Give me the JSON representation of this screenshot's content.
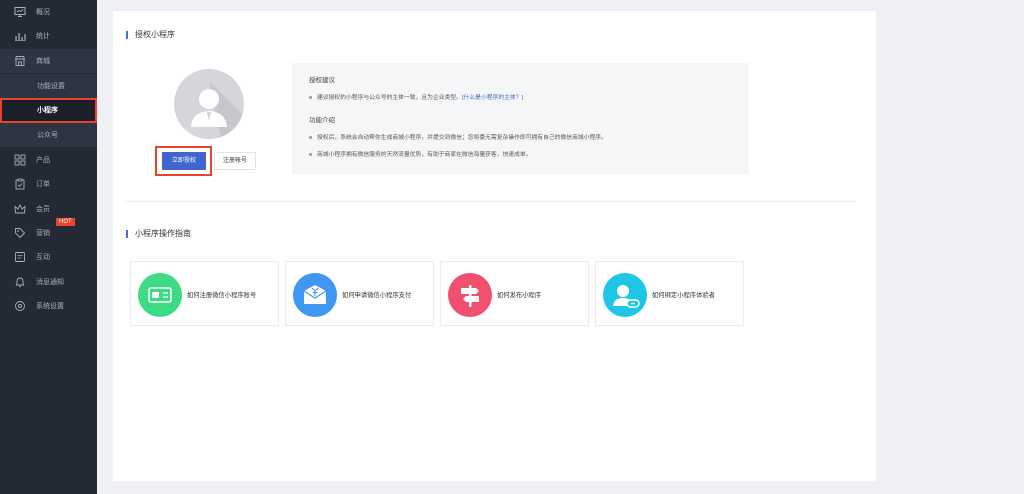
{
  "sidebar": {
    "items": [
      {
        "label": "概况",
        "icon": "dashboard-icon"
      },
      {
        "label": "统计",
        "icon": "chart-icon"
      },
      {
        "label": "商城",
        "icon": "store-icon"
      },
      {
        "label": "功能设置",
        "icon": ""
      },
      {
        "label": "小程序",
        "icon": ""
      },
      {
        "label": "公众号",
        "icon": ""
      },
      {
        "label": "产品",
        "icon": "grid-icon"
      },
      {
        "label": "订单",
        "icon": "clipboard-icon"
      },
      {
        "label": "会员",
        "icon": "crown-icon"
      },
      {
        "label": "营销",
        "icon": "tag-icon"
      },
      {
        "label": "互动",
        "icon": "chat-icon"
      },
      {
        "label": "消息通知",
        "icon": "bell-icon"
      },
      {
        "label": "系统设置",
        "icon": "settings-icon"
      }
    ],
    "badge": "HOT",
    "colors": {
      "background": "#232935",
      "highlight": "#e8442c"
    }
  },
  "main": {
    "auth_section_title": "授权小程序",
    "auth_button": "立即授权",
    "register_button": "注册帐号",
    "info": {
      "suggest_title": "授权建议",
      "suggest_text": "建议授权的小程序与公众号的主体一致，且为企业类型。",
      "suggest_link": "[什么是小程序的主体？]",
      "feature_title": "功能介绍",
      "feature_1": "授权后，系统会自动帮你生成商城小程序，并提交到微信；您将委无需复杂操作即可拥有自己的微信商城小程序。",
      "feature_2": "商城小程序拥有微信服务的天然流量优势，有助于商家在微信海量获客，快速成单。"
    },
    "guide_section_title": "小程序操作指南",
    "guides": [
      {
        "label": "如何注册微信小程序账号",
        "icon": "wallet-icon",
        "color": "#3ddc84"
      },
      {
        "label": "如何申请微信小程序支付",
        "icon": "payment-icon",
        "color": "#4096f3"
      },
      {
        "label": "如何发布小程序",
        "icon": "signpost-icon",
        "color": "#f0506e"
      },
      {
        "label": "如何绑定小程序体验者",
        "icon": "user-link-icon",
        "color": "#1fc6e6"
      }
    ],
    "accent_color": "#4164cf"
  }
}
